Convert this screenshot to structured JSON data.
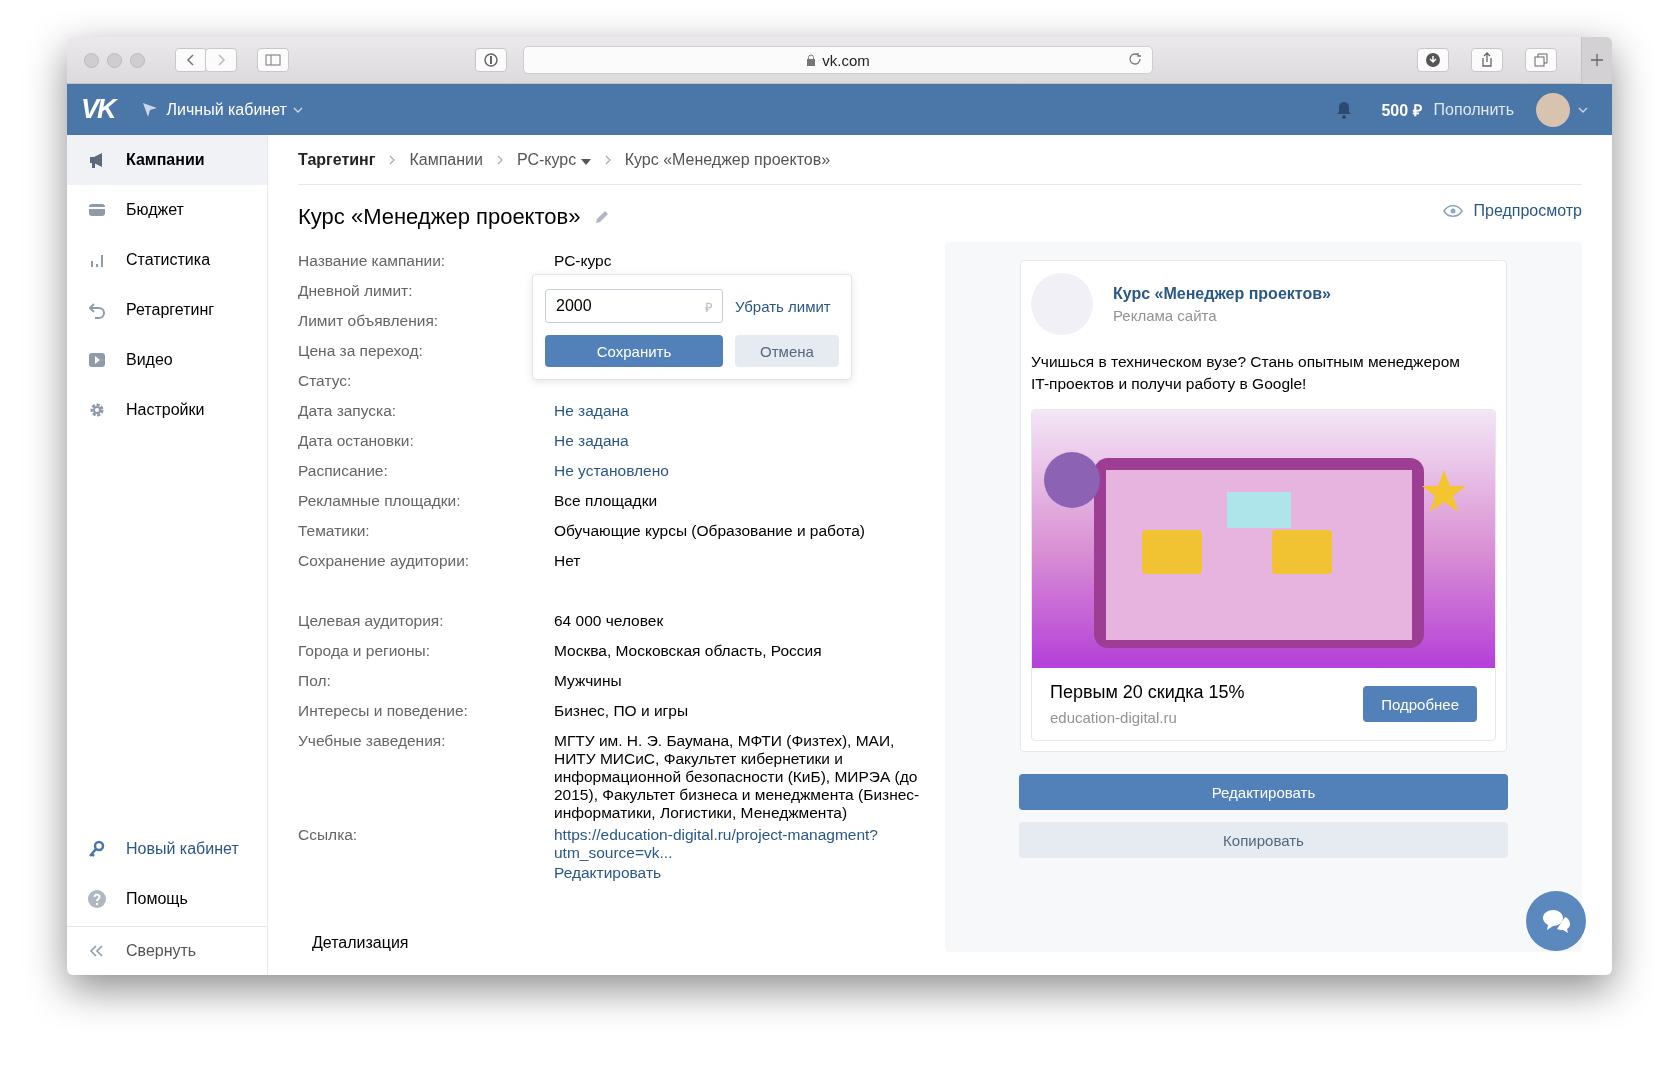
{
  "browser": {
    "url": "vk.com"
  },
  "header": {
    "logo": "VK",
    "cabinet": "Личный кабинет",
    "balance": "500 ₽",
    "top_up": "Пополнить"
  },
  "sidebar": {
    "items": [
      {
        "label": "Кампании",
        "selected": true
      },
      {
        "label": "Бюджет",
        "selected": false
      },
      {
        "label": "Статистика",
        "selected": false
      },
      {
        "label": "Ретаргетинг",
        "selected": false
      },
      {
        "label": "Видео",
        "selected": false
      },
      {
        "label": "Настройки",
        "selected": false
      }
    ],
    "bottom_items": [
      {
        "label": "Новый кабинет",
        "kind": "link"
      },
      {
        "label": "Помощь",
        "kind": "plain"
      }
    ],
    "collapse": "Свернуть"
  },
  "breadcrumbs": [
    {
      "label": "Таргетинг",
      "dropdown": false
    },
    {
      "label": "Кампании",
      "dropdown": false
    },
    {
      "label": "РС-курс",
      "dropdown": true
    },
    {
      "label": "Курс «Менеджер проектов»",
      "dropdown": false
    }
  ],
  "title": "Курс «Менеджер проектов»",
  "preview_link": "Предпросмотр",
  "settings_rows": [
    {
      "label": "Название кампании:",
      "value": "РС-курс",
      "kind": "plain"
    },
    {
      "label": "Дневной лимит:"
    },
    {
      "label": "Лимит объявления:"
    },
    {
      "label": "Цена за переход:"
    },
    {
      "label": "Статус:"
    },
    {
      "label": "Дата запуска:",
      "value": "Не задана",
      "kind": "link"
    },
    {
      "label": "Дата остановки:",
      "value": "Не задана",
      "kind": "link"
    },
    {
      "label": "Расписание:",
      "value": "Не установлено",
      "kind": "link"
    },
    {
      "label": "Рекламные площадки:",
      "value": "Все площадки",
      "kind": "plain"
    },
    {
      "label": "Тематики:",
      "value": "Обучающие курсы (Образование и работа)",
      "kind": "plain"
    },
    {
      "label": "Сохранение аудитории:",
      "value": "Нет",
      "kind": "plain"
    }
  ],
  "audience_rows": [
    {
      "label": "Целевая аудитория:",
      "value": "64 000 человек",
      "kind": "plain"
    },
    {
      "label": "Города и регионы:",
      "value": "Москва, Московская область, Россия",
      "kind": "plain"
    },
    {
      "label": "Пол:",
      "value": "Мужчины",
      "kind": "plain"
    },
    {
      "label": "Интересы и поведение:",
      "value": "Бизнес, ПО и игры",
      "kind": "plain"
    },
    {
      "label": "Учебные заведения:",
      "value": "МГТУ им. Н. Э. Баумана, МФТИ (Физтех), МАИ, НИТУ МИСиС, Факультет кибернетики и информационной безопасности (КиБ), МИРЭА (до 2015), Факультет бизнеса и менеджмента (Бизнес-информатики, Логистики, Менеджмента)",
      "kind": "plain"
    },
    {
      "label": "Ссылка:",
      "value": "https://education-digital.ru/project-managment?utm_source=vk...",
      "kind": "link"
    }
  ],
  "edit_link": "Редактировать",
  "details_heading": "Детализация",
  "limit_popup": {
    "value": "2000",
    "currency": "₽",
    "remove_link": "Убрать лимит",
    "save": "Сохранить",
    "cancel": "Отмена"
  },
  "preview": {
    "ad_title": "Курс «Менеджер проектов»",
    "ad_subtitle": "Реклама сайта",
    "text": "Учишься в техническом вузе? Стань опытным менеджером IT-проектов и получи работу в Google!",
    "offer": "Первым 20 скидка 15%",
    "domain": "education-digital.ru",
    "cta": "Подробнее",
    "edit": "Редактировать",
    "copy": "Копировать"
  }
}
